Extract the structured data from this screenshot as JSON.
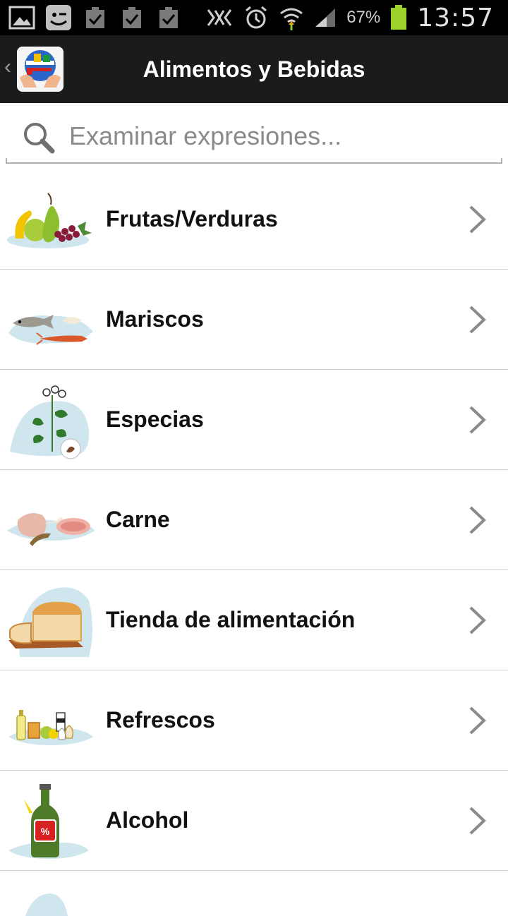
{
  "status_bar": {
    "battery": "67%",
    "time": "13:57"
  },
  "action_bar": {
    "title": "Alimentos y Bebidas"
  },
  "search": {
    "placeholder": "Examinar expresiones..."
  },
  "categories": [
    {
      "label": "Frutas/Verduras",
      "icon": "fruits-vegetables-illustration"
    },
    {
      "label": "Mariscos",
      "icon": "seafood-illustration"
    },
    {
      "label": "Especias",
      "icon": "spices-illustration"
    },
    {
      "label": "Carne",
      "icon": "meat-illustration"
    },
    {
      "label": "Tienda de alimentación",
      "icon": "grocery-store-illustration"
    },
    {
      "label": "Refrescos",
      "icon": "soft-drinks-illustration"
    },
    {
      "label": "Alcohol",
      "icon": "alcohol-illustration"
    }
  ],
  "colors": {
    "status_bar": "#000000",
    "action_bar": "#1b1b1b",
    "divider": "#cfcfcf",
    "illustration_splash": "#cfe6ee"
  }
}
